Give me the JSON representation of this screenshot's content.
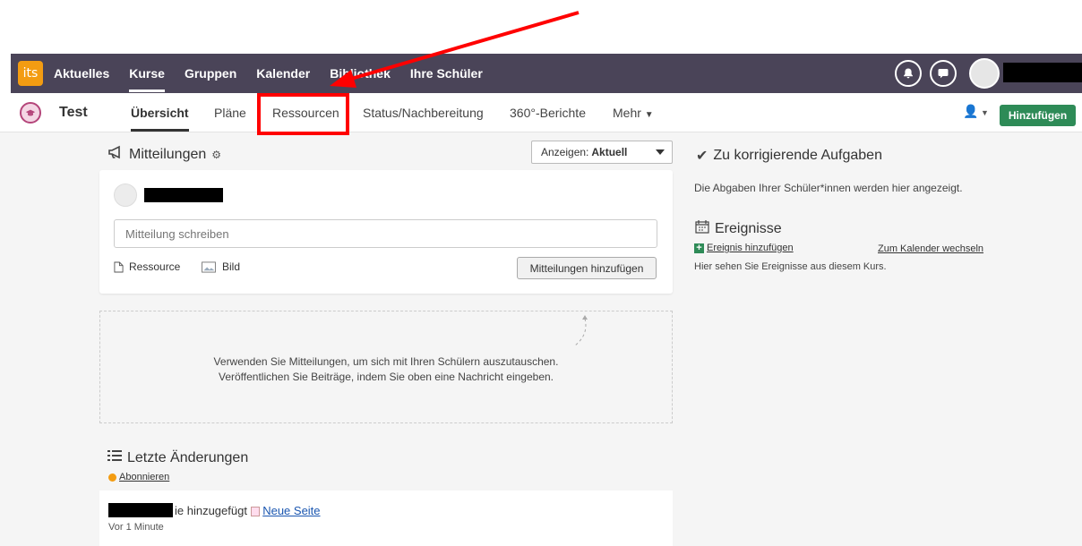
{
  "topnav": {
    "logo_text": "its",
    "items": [
      "Aktuelles",
      "Kurse",
      "Gruppen",
      "Kalender",
      "Bibliothek",
      "Ihre Schüler"
    ],
    "active_index": 1,
    "bg_color": "#4a4458"
  },
  "subnav": {
    "course_title": "Test",
    "tabs": [
      "Übersicht",
      "Pläne",
      "Ressourcen",
      "Status/Nachbereitung",
      "360°-Berichte",
      "Mehr"
    ],
    "active_index": 0,
    "add_button": "Hinzufügen"
  },
  "updates": {
    "title": "Mitteilungen",
    "show_label": "Anzeigen:",
    "show_value": "Aktuell",
    "input_placeholder": "Mitteilung schreiben",
    "attach_resource": "Ressource",
    "attach_image": "Bild",
    "post_button": "Mitteilungen hinzufügen",
    "empty_line1": "Verwenden Sie Mitteilungen, um sich mit Ihren Schülern auszutauschen.",
    "empty_line2": "Veröffentlichen Sie Beiträge, indem Sie oben eine Nachricht eingeben."
  },
  "recent": {
    "title": "Letzte Änderungen",
    "subscribe": "Abonnieren",
    "change_text": "ie hinzugefügt",
    "change_link": "Neue Seite",
    "change_time": "Vor 1 Minute"
  },
  "todo": {
    "title": "Zu korrigierende Aufgaben",
    "description": "Die Abgaben Ihrer Schüler*innen werden hier angezeigt."
  },
  "events": {
    "title": "Ereignisse",
    "add_link": "Ereignis hinzufügen",
    "calendar_link": "Zum Kalender wechseln",
    "description": "Hier sehen Sie Ereignisse aus diesem Kurs."
  },
  "colors": {
    "accent_green": "#2e8b57",
    "annotation_red": "#ff0000",
    "logo_orange": "#f39c12"
  }
}
